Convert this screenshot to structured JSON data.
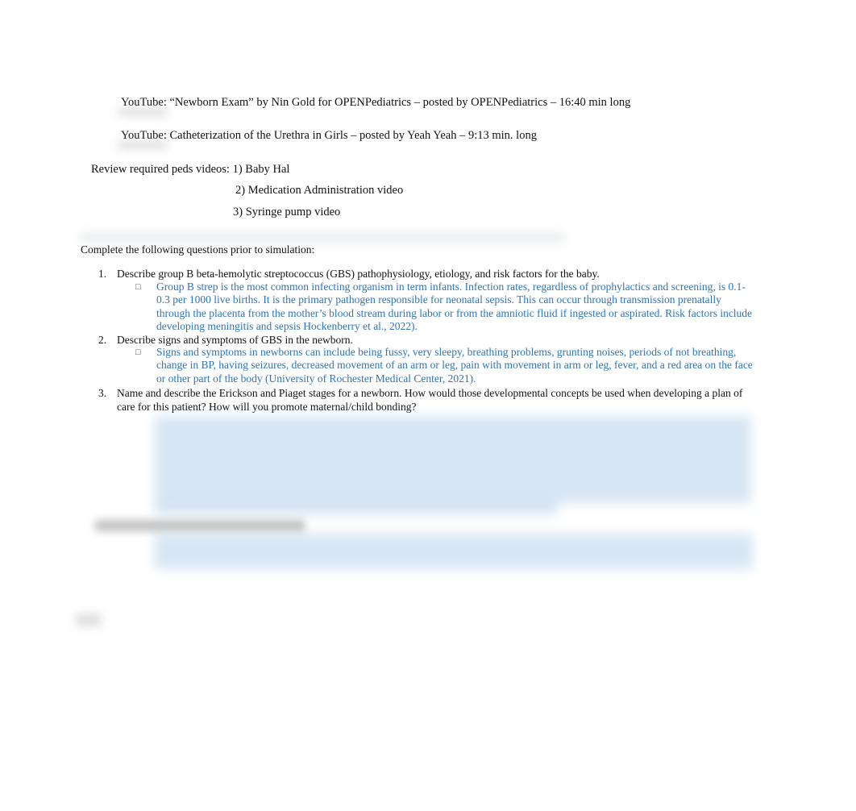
{
  "videos": [
    {
      "source": "YouTube",
      "text": ": “Newborn Exam” by Nin Gold for OPENPediatrics – posted by OPENPediatrics – 16:40 min long"
    },
    {
      "source": "YouTube",
      "text": ": Catheterization of the Urethra in Girls – posted by Yeah Yeah – 9:13 min. long"
    }
  ],
  "review": {
    "label": "Review required peds videos: ",
    "items": [
      "1) Baby Hal",
      "2) Medication Administration video",
      "3) Syringe pump video"
    ]
  },
  "intro": "Complete the following questions prior to simulation:",
  "questions": [
    {
      "number": "1.",
      "text": "Describe group B beta-hemolytic streptococcus (GBS) pathophysiology, etiology, and risk factors for the baby.",
      "answer": "Group B strep is the most common infecting organism in term infants. Infection rates, regardless of prophylactics and screening, is 0.1-0.3 per 1000 live births. It is the primary pathogen responsible for neonatal sepsis. This can occur through transmission prenatally through the placenta from the mother’s blood stream during labor or from the amniotic fluid if ingested or aspirated. Risk factors include developing meningitis and sepsis Hockenberry et al., 2022)."
    },
    {
      "number": "2.",
      "text": "Describe signs and symptoms of GBS in the newborn.",
      "answer": "Signs and symptoms in newborns can include being fussy, very sleepy, breathing problems, grunting noises, periods of not breathing, change in BP, having seizures, decreased movement of an arm or leg, pain with movement in arm or leg, fever, and a red area on the face or other part of the body (University of Rochester Medical Center, 2021)."
    },
    {
      "number": "3.",
      "text": "Name and describe the Erickson and Piaget stages for a newborn. How would those developmental concepts be used when developing a plan of care for this patient? How will you promote maternal/child bonding?"
    }
  ],
  "bullet_glyph": "",
  "colors": {
    "answer": "#2e74b5",
    "text": "#111111"
  }
}
